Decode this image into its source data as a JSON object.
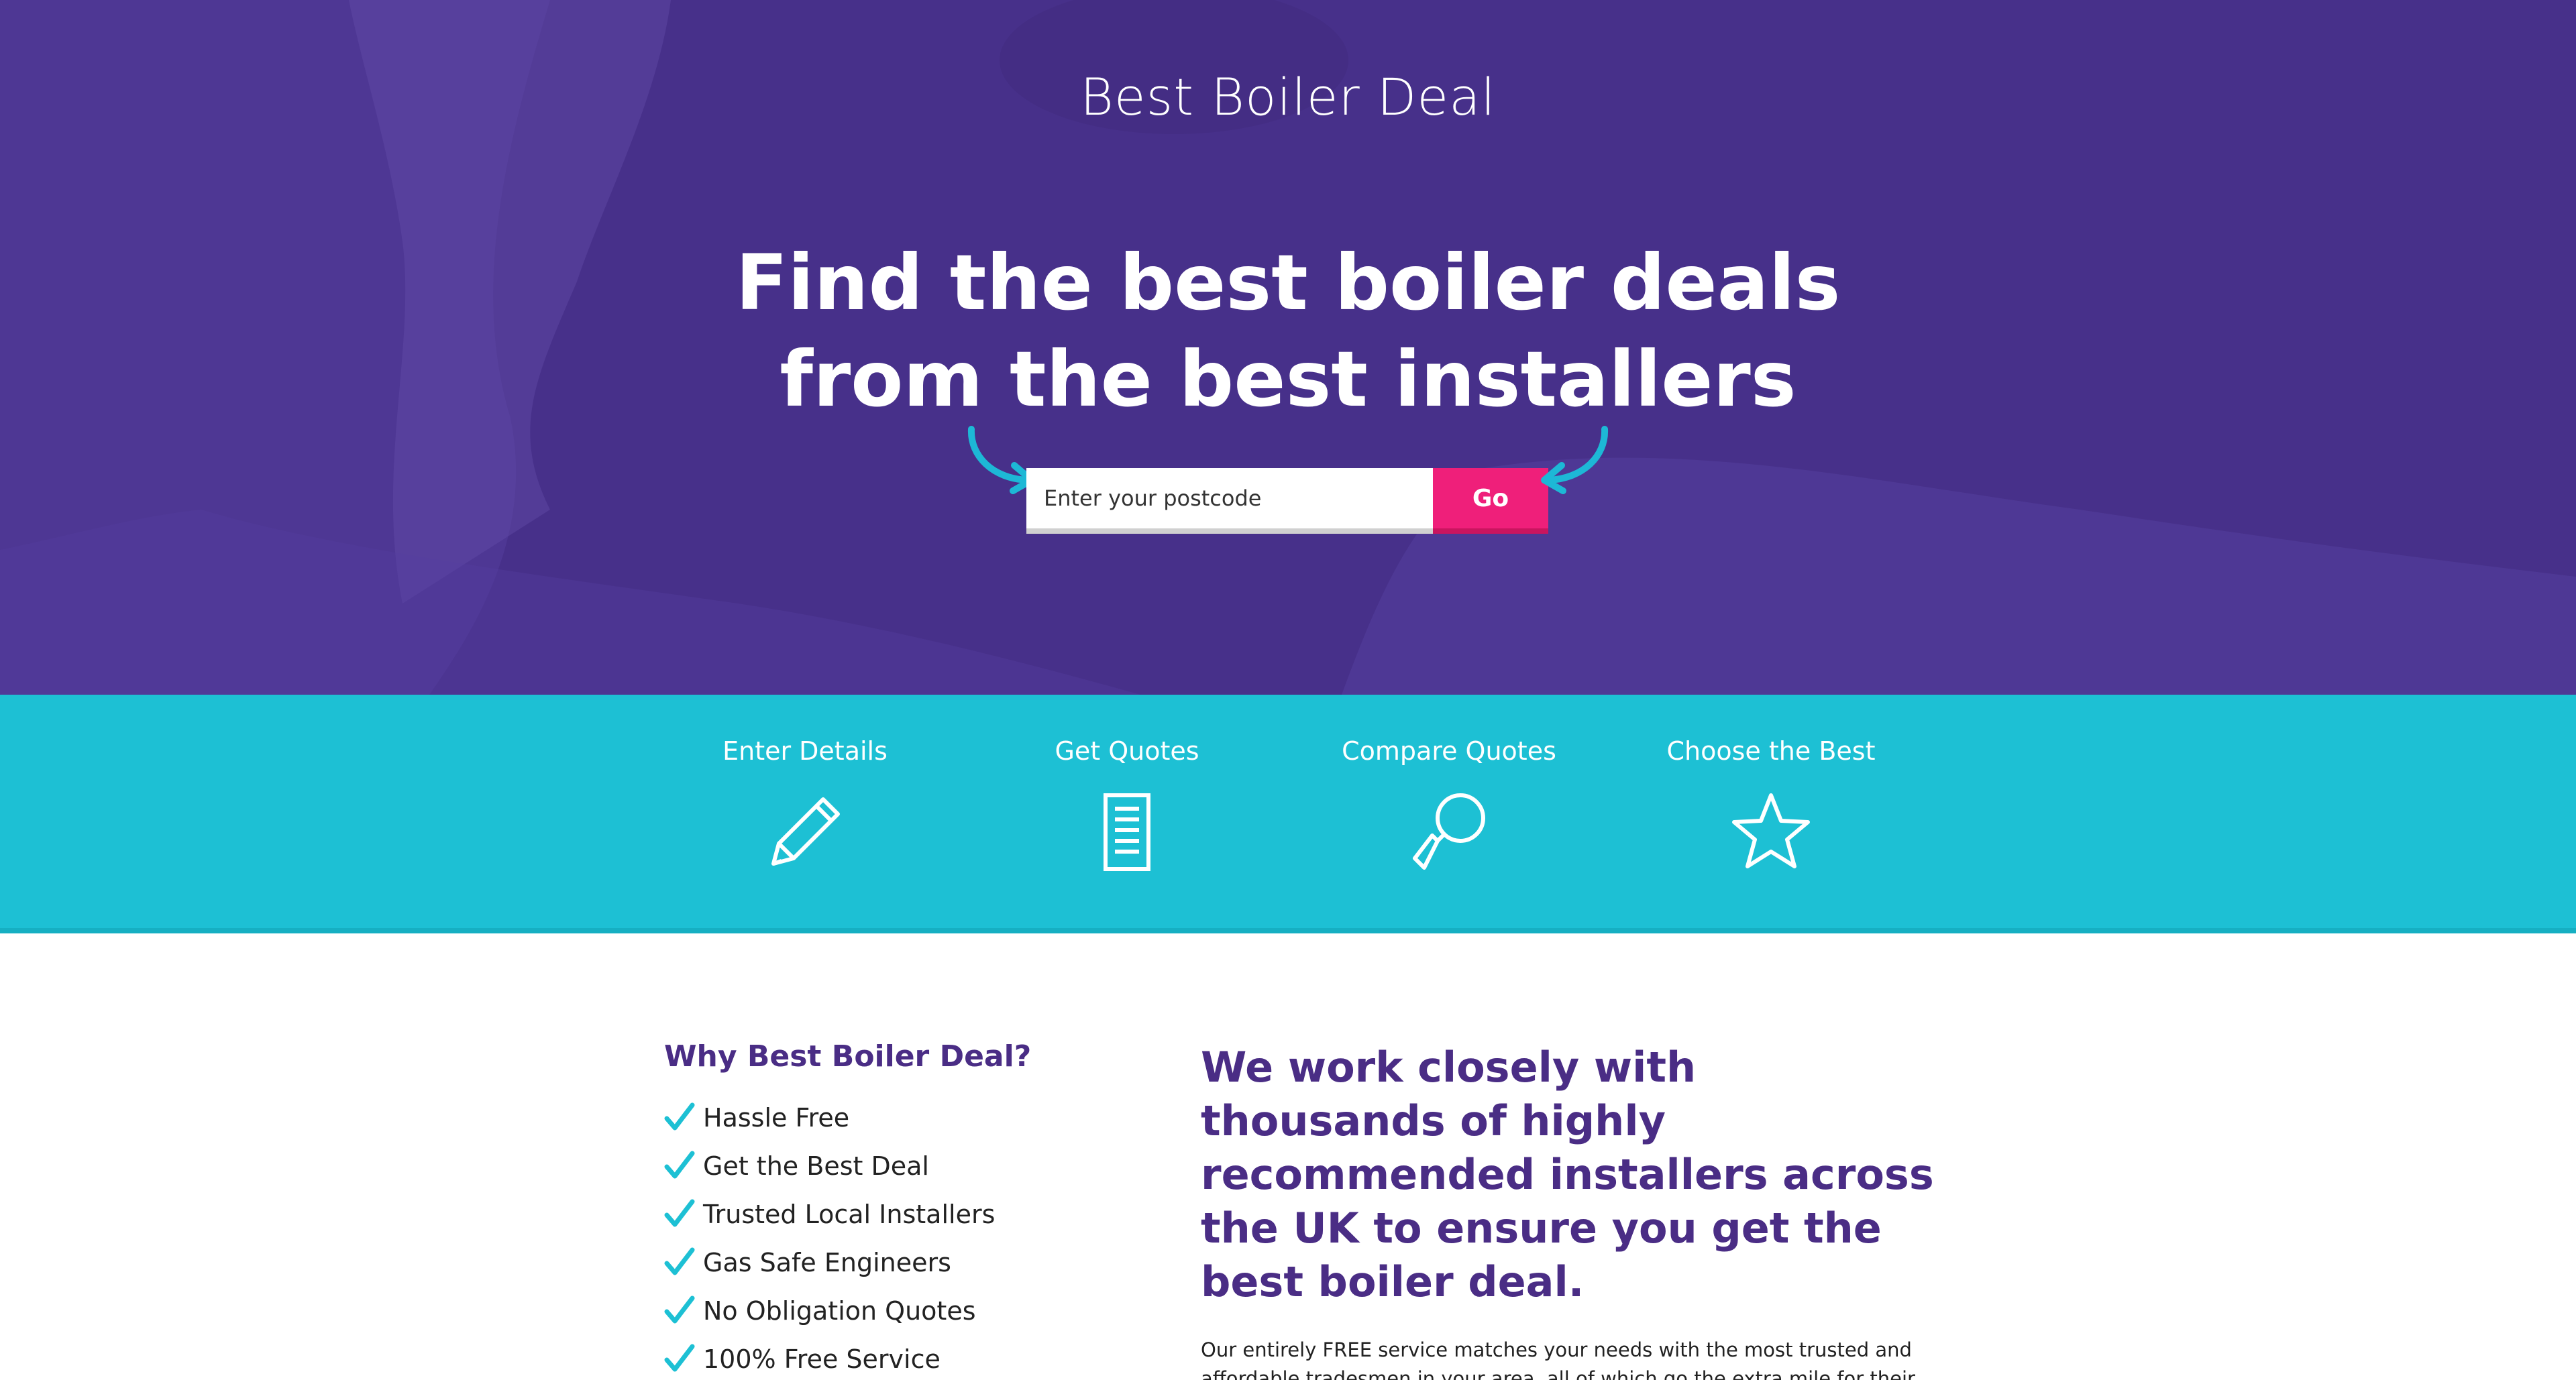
{
  "brand": {
    "logo": "Best Boiler Deal"
  },
  "hero": {
    "title_line1": "Find the best boiler deals",
    "title_line2": "from the best installers",
    "postcode_placeholder": "Enter your postcode",
    "go_label": "Go"
  },
  "steps": [
    {
      "label": "Enter Details",
      "icon": "pencil-icon"
    },
    {
      "label": "Get Quotes",
      "icon": "document-icon"
    },
    {
      "label": "Compare Quotes",
      "icon": "magnifier-icon"
    },
    {
      "label": "Choose the Best",
      "icon": "star-icon"
    }
  ],
  "why": {
    "title": "Why Best Boiler Deal?",
    "items": [
      "Hassle Free",
      "Get the Best Deal",
      "Trusted Local Installers",
      "Gas Safe Engineers",
      "No Obligation Quotes",
      "100% Free Service"
    ]
  },
  "about": {
    "heading": "We work closely with thousands of highly recommended installers across the UK to ensure you get the best boiler deal.",
    "body": "Our entirely FREE service matches your needs with the most trusted and affordable tradesmen in your area, all of which go the extra mile for their customers."
  },
  "colors": {
    "hero_purple": "#4a2d85",
    "teal": "#1dc0d4",
    "pink": "#ef1f7a",
    "arrow_blue": "#1db8d6"
  }
}
